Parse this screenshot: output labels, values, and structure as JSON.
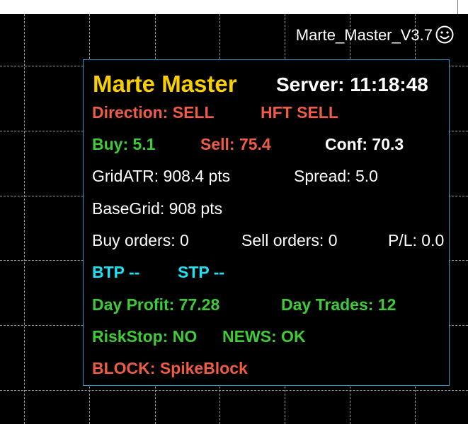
{
  "colors": {
    "gold": "#f7cf00",
    "red": "#ee5c44",
    "green": "#3ecb38",
    "cyan": "#1de3f6",
    "white": "#ffffff",
    "panel_border": "#2f94c6"
  },
  "chart": {
    "ea_label": "Marte_Master_V3.7",
    "smiley_icon": "smiley-face-icon"
  },
  "panel": {
    "title": "Marte Master",
    "server_time": "Server: 11:18:48",
    "direction": "Direction: SELL",
    "hft": "HFT SELL",
    "buy": "Buy: 5.1",
    "sell": "Sell: 75.4",
    "conf": "Conf: 70.3",
    "grid_atr": "GridATR: 908.4 pts",
    "spread": "Spread: 5.0",
    "base_grid": "BaseGrid: 908 pts",
    "buy_orders": "Buy orders: 0",
    "sell_orders": "Sell orders: 0",
    "pl": "P/L: 0.0",
    "btp": "BTP --",
    "stp": "STP --",
    "day_profit": "Day Profit: 77.28",
    "day_trades": "Day Trades: 12",
    "risk_stop": "RiskStop: NO",
    "news": "NEWS: OK",
    "block": "BLOCK: SpikeBlock"
  }
}
